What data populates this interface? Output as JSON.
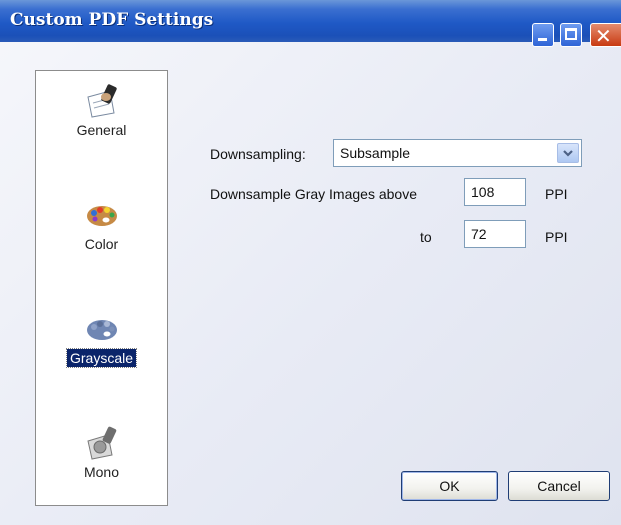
{
  "window": {
    "title": "Custom PDF Settings",
    "controls": [
      "minimize",
      "maximize",
      "close"
    ]
  },
  "sidebar": {
    "items": [
      {
        "label": "General",
        "icon": "general-settings-icon",
        "selected": false
      },
      {
        "label": "Color",
        "icon": "color-palette-icon",
        "selected": false
      },
      {
        "label": "Grayscale",
        "icon": "grayscale-palette-icon",
        "selected": true
      },
      {
        "label": "Mono",
        "icon": "mono-icon",
        "selected": false
      }
    ]
  },
  "settings": {
    "downsampling_label": "Downsampling:",
    "downsampling_value": "Subsample",
    "above_label": "Downsample Gray Images above",
    "above_value": "108",
    "to_label": "to",
    "to_value": "72",
    "unit_label": "PPI"
  },
  "buttons": {
    "ok": "OK",
    "cancel": "Cancel"
  },
  "colors": {
    "titlebar": "#1f59c6",
    "selection": "#0a246a",
    "close_button": "#c83a12"
  }
}
